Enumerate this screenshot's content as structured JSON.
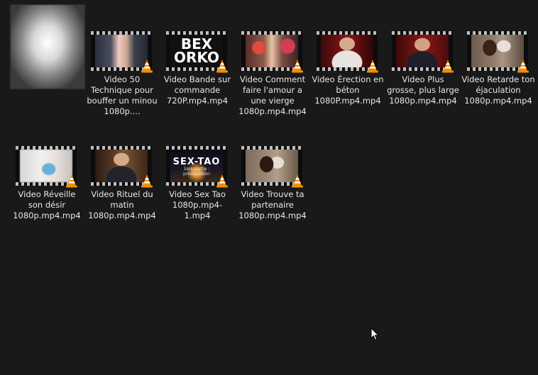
{
  "files": [
    {
      "id": "f1",
      "label": "Video 50 Technique pour bouffer un minou 1080p...."
    },
    {
      "id": "f2",
      "label": "Video Bande sur commande 720P.mp4.mp4",
      "thumb_text": "BEX\nORKO"
    },
    {
      "id": "f3",
      "label": "Video Comment faire l'amour a une vierge 1080p.mp4.mp4"
    },
    {
      "id": "f4",
      "label": "Video Érection en béton 1080P.mp4.mp4"
    },
    {
      "id": "f5",
      "label": "Video Plus grosse, plus large 1080p.mp4.mp4"
    },
    {
      "id": "f6",
      "label": "Video Retarde ton éjaculation 1080p.mp4.mp4"
    },
    {
      "id": "f7",
      "label": "Video Réveille son désir 1080p.mp4.mp4"
    },
    {
      "id": "f8",
      "label": "Video Rituel du matin 1080p.mp4.mp4"
    },
    {
      "id": "f9",
      "label": "Video Sex Tao 1080p.mp4-1.mp4",
      "thumb_text": "SEX-TAO",
      "thumb_sub": "1ère partie : présentation"
    },
    {
      "id": "f10",
      "label": "Video Trouve ta partenaire 1080p.mp4.mp4"
    }
  ],
  "colors": {
    "background": "#191919",
    "label_text": "#e8e8e8",
    "vlc_orange": "#f28c00"
  },
  "icons": {
    "file_overlay": "vlc-cone-icon",
    "pointer": "mouse-cursor-icon"
  }
}
